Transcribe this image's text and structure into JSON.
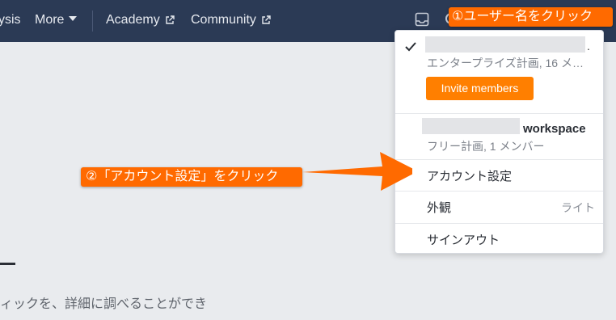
{
  "nav": {
    "analysis_fragment": "ysis",
    "more": "More",
    "academy": "Academy",
    "community": "Community"
  },
  "callouts": {
    "step1": "①ユーザー名をクリック",
    "step2": "②「アカウント設定」をクリック"
  },
  "dropdown": {
    "current_org_dot": ".",
    "current_org_plan": "エンタープライズ計画, 16 メ…",
    "invite_button": "Invite members",
    "other_org_suffix": "workspace",
    "other_org_plan": "フリー計画, 1 メンバー",
    "account_settings": "アカウント設定",
    "appearance": "外観",
    "appearance_value": "ライト",
    "sign_out": "サインアウト"
  },
  "page": {
    "body_text": "ィックを、詳細に調べることができ"
  },
  "colors": {
    "nav_bg": "#2b3a55",
    "callout": "#ff6a00",
    "invite_button": "#ff7f00"
  }
}
